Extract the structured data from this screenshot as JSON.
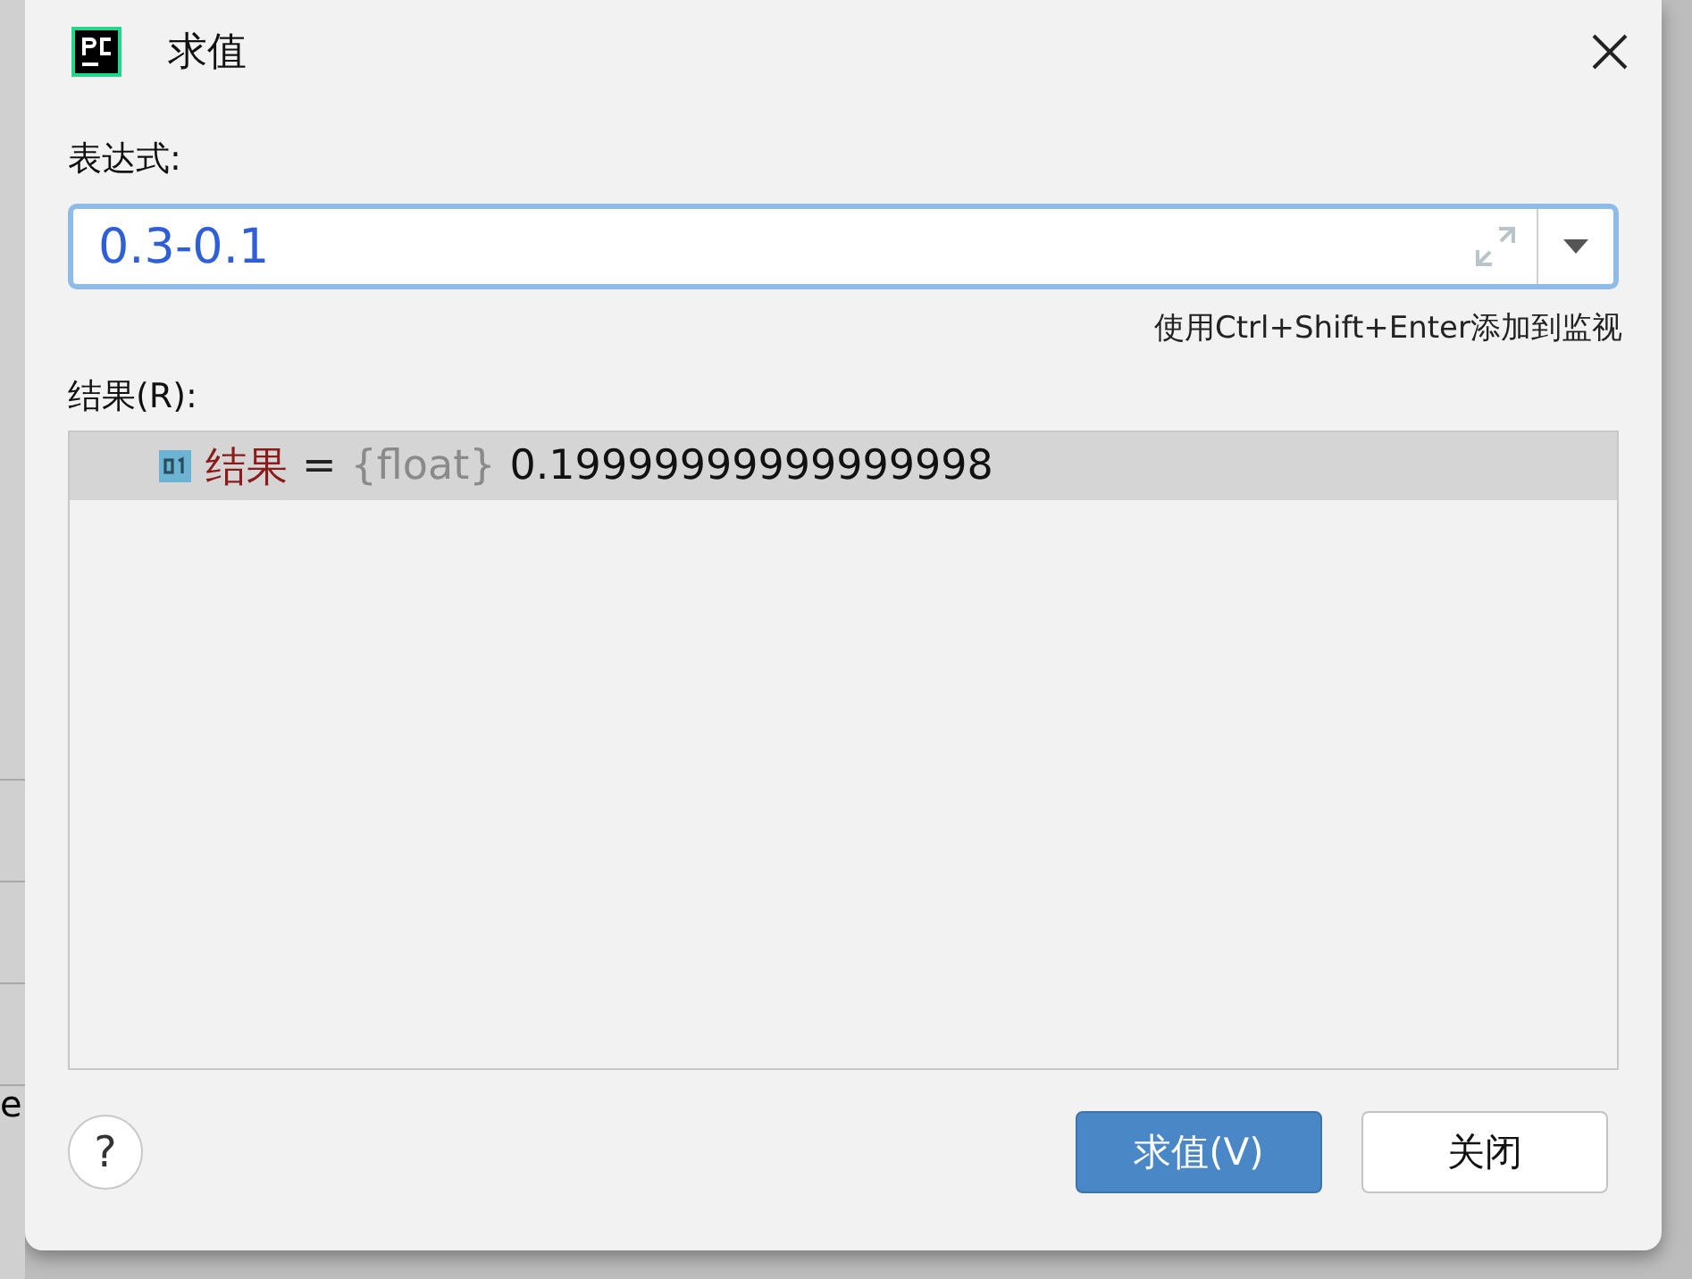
{
  "background": {
    "text": "e"
  },
  "window": {
    "title": "求值"
  },
  "expression": {
    "label": "表达式:",
    "value": "0.3-0.1",
    "focused": true
  },
  "hint": "使用Ctrl+Shift+Enter添加到监视",
  "result": {
    "label": "结果(R):",
    "rows": [
      {
        "name": "结果",
        "equals": "=",
        "type": "{float}",
        "value": "0.19999999999999998",
        "selected": true
      }
    ]
  },
  "buttons": [
    {
      "label": "求值(V)",
      "kind": "primary"
    },
    {
      "label": "关闭",
      "kind": "secondary"
    }
  ],
  "help": "?"
}
